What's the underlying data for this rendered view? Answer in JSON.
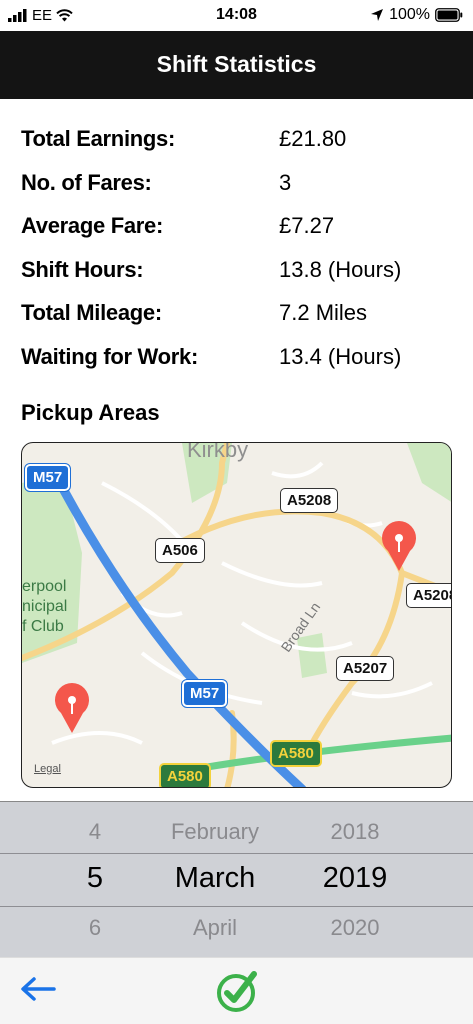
{
  "status_bar": {
    "carrier": "EE",
    "time": "14:08",
    "battery": "100%"
  },
  "nav": {
    "title": "Shift Statistics"
  },
  "stats": [
    {
      "label": "Total Earnings:",
      "value": "£21.80"
    },
    {
      "label": "No. of Fares:",
      "value": "3"
    },
    {
      "label": "Average Fare:",
      "value": "£7.27"
    },
    {
      "label": "Shift Hours:",
      "value": "13.8 (Hours)"
    },
    {
      "label": "Total Mileage:",
      "value": "7.2 Miles"
    },
    {
      "label": "Waiting for Work:",
      "value": "13.4 (Hours)"
    }
  ],
  "pickup": {
    "title": "Pickup Areas"
  },
  "map": {
    "town": "Kirkby",
    "roads": {
      "m57_top": "M57",
      "m57_mid": "M57",
      "a506": "A506",
      "a5208_top": "A5208",
      "a5208_right": "A5208",
      "a5207": "A5207",
      "a580_left": "A580",
      "a580_mid": "A580"
    },
    "street": "Broad Ln",
    "poi": "erpool\nnicipal\nf Club",
    "legal": "Legal",
    "colors": {
      "motorway": "#4a8fe7",
      "a_road": "#f6d58a",
      "green_road": "#6ad18a",
      "park": "#cde8c0",
      "pin": "#f4574b"
    }
  },
  "picker": {
    "day": {
      "prev": "4",
      "selected": "5",
      "next": "6"
    },
    "month": {
      "prev": "February",
      "selected": "March",
      "next": "April"
    },
    "year": {
      "prev": "2018",
      "selected": "2019",
      "next": "2020"
    }
  },
  "toolbar": {
    "back_icon": "left-arrow-icon",
    "done_icon": "check-circle-icon",
    "accent": "#1a73e8",
    "done_color": "#3cb14a"
  }
}
